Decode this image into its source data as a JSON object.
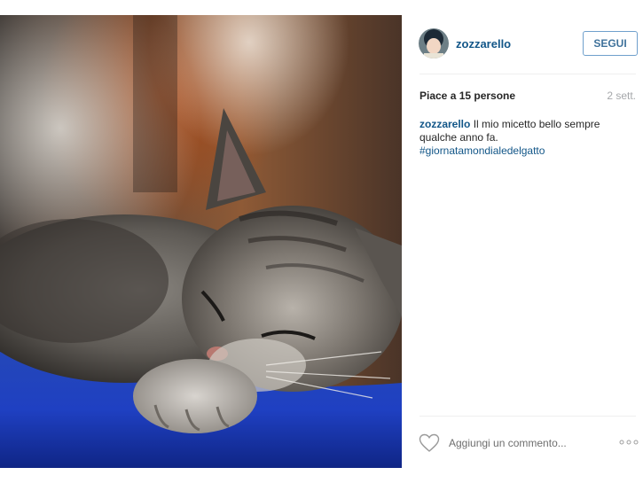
{
  "post": {
    "photo": {
      "subject": "sleeping tabby kitten on blue cushion"
    },
    "header": {
      "username": "zozzarello",
      "follow_label": "SEGUI"
    },
    "likes_text": "Piace a 15 persone",
    "timestamp": "2 sett.",
    "caption": {
      "username": "zozzarello",
      "text": " Il mio micetto bello sempre qualche anno fa.",
      "hashtag": "#giornatamondialedelgatto"
    },
    "comment": {
      "placeholder": "Aggiungi un commento..."
    },
    "icons": {
      "like": "heart-icon",
      "more": "more-options-icon"
    },
    "colors": {
      "link": "#125688",
      "follow_border": "#70a0cc",
      "follow_text": "#3f729b",
      "cushion_blue": "#1f45c9"
    }
  }
}
